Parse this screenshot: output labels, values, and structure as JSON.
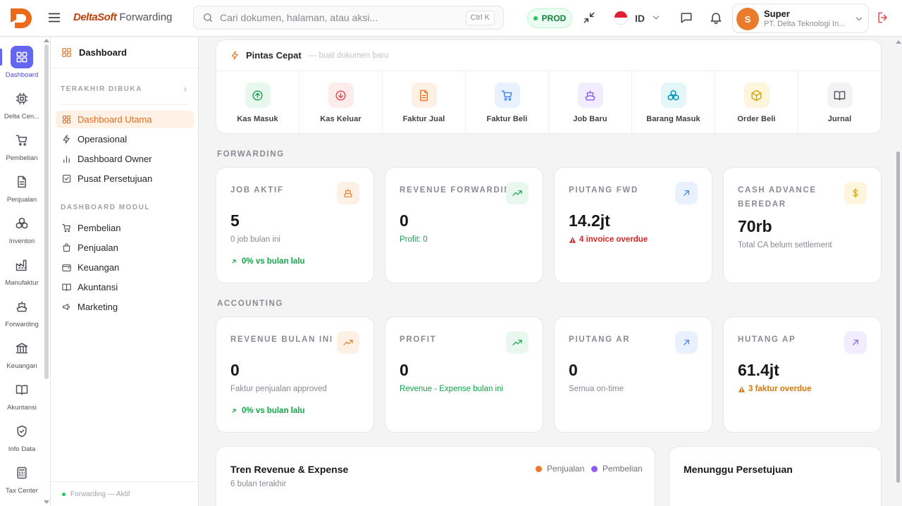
{
  "app": {
    "brand_name": "DeltaSoft",
    "module_name": "Forwarding"
  },
  "search": {
    "placeholder": "Cari dokumen, halaman, atau aksi...",
    "shortcut": "Ctrl K"
  },
  "env_badge": "PROD",
  "language": "ID",
  "user": {
    "initial": "S",
    "name": "Super",
    "company": "PT. Delta Teknologi In..."
  },
  "rail": {
    "items": [
      {
        "label": "Dashboard",
        "icon": "dashboard-icon",
        "active": true
      },
      {
        "label": "Delta Cen...",
        "icon": "cpu-icon"
      },
      {
        "label": "Pembelian",
        "icon": "cart-icon"
      },
      {
        "label": "Penjualan",
        "icon": "document-icon"
      },
      {
        "label": "Inventori",
        "icon": "boxes-icon"
      },
      {
        "label": "Manufaktur",
        "icon": "factory-icon"
      },
      {
        "label": "Forwarding",
        "icon": "ship-icon"
      },
      {
        "label": "Keuangan",
        "icon": "bank-icon"
      },
      {
        "label": "Akuntansi",
        "icon": "book-icon"
      },
      {
        "label": "Info Data",
        "icon": "shield-icon"
      },
      {
        "label": "Tax Center",
        "icon": "calculator-icon"
      }
    ]
  },
  "panel": {
    "title": "Dashboard",
    "recent_label": "TERAKHIR DIBUKA",
    "items": [
      {
        "label": "Dashboard Utama",
        "icon": "dashboard-icon",
        "active": true
      },
      {
        "label": "Operasional",
        "icon": "lightning-icon"
      },
      {
        "label": "Dashboard Owner",
        "icon": "bar-chart-icon"
      },
      {
        "label": "Pusat Persetujuan",
        "icon": "check-square-icon"
      }
    ],
    "module_label": "DASHBOARD MODUL",
    "modules": [
      {
        "label": "Pembelian",
        "icon": "cart-icon"
      },
      {
        "label": "Penjualan",
        "icon": "bag-icon"
      },
      {
        "label": "Keuangan",
        "icon": "wallet-icon"
      },
      {
        "label": "Akuntansi",
        "icon": "book-icon"
      },
      {
        "label": "Marketing",
        "icon": "megaphone-icon"
      }
    ],
    "footer": "Forwarding — Aktif"
  },
  "quick_actions": {
    "title": "Pintas Cepat",
    "subtitle": "— buat dokumen baru",
    "items": [
      {
        "label": "Kas Masuk",
        "icon": "arrow-up-circle-icon",
        "color": "#16a34a",
        "bg": "#e8f8ee"
      },
      {
        "label": "Kas Keluar",
        "icon": "arrow-down-circle-icon",
        "color": "#ef4444",
        "bg": "#fdecec"
      },
      {
        "label": "Faktur Jual",
        "icon": "invoice-icon",
        "color": "#ea7a2c",
        "bg": "#fdf0e4"
      },
      {
        "label": "Faktur Beli",
        "icon": "cart-icon",
        "color": "#3b82f6",
        "bg": "#e9f1fe"
      },
      {
        "label": "Job Baru",
        "icon": "ship-icon",
        "color": "#8b5cf6",
        "bg": "#f1ecfe"
      },
      {
        "label": "Barang Masuk",
        "icon": "boxes-icon",
        "color": "#0891b2",
        "bg": "#e3f6f8"
      },
      {
        "label": "Order Beli",
        "icon": "package-icon",
        "color": "#d9a100",
        "bg": "#fdf6dc"
      },
      {
        "label": "Jurnal",
        "icon": "book-icon",
        "color": "#52525b",
        "bg": "#f4f4f5"
      }
    ]
  },
  "forwarding": {
    "label": "FORWARDING",
    "cards": [
      {
        "label": "JOB AKTIF",
        "value": "5",
        "sub": "0 job bulan ini",
        "trend": "0% vs bulan lalu",
        "icon": "ship-icon",
        "color": "#ea7a2c",
        "bg": "#fdf0e4"
      },
      {
        "label": "REVENUE FORWARDING",
        "value": "0",
        "sub": "Profit: 0",
        "icon": "trending-up-icon",
        "color": "#16a34a",
        "bg": "#e8f8ee"
      },
      {
        "label": "PIUTANG FWD",
        "value": "14.2jt",
        "warning": "4 invoice overdue",
        "icon": "arrow-up-right-icon",
        "color": "#3b82f6",
        "bg": "#e9f1fe"
      },
      {
        "label": "CASH ADVANCE BEREDAR",
        "value": "70rb",
        "sub": "Total CA belum settlement",
        "icon": "dollar-icon",
        "color": "#d9a100",
        "bg": "#fdf6dc"
      }
    ]
  },
  "accounting": {
    "label": "ACCOUNTING",
    "cards": [
      {
        "label": "REVENUE BULAN INI",
        "value": "0",
        "sub": "Faktur penjualan approved",
        "trend": "0% vs bulan lalu",
        "icon": "trending-up-icon",
        "color": "#ea7a2c",
        "bg": "#fdf0e4"
      },
      {
        "label": "PROFIT",
        "value": "0",
        "sub": "Revenue - Expense bulan ini",
        "icon": "trending-up-icon",
        "color": "#16a34a",
        "bg": "#e8f8ee"
      },
      {
        "label": "PIUTANG AR",
        "value": "0",
        "sub": "Semua on-time",
        "icon": "arrow-up-right-icon",
        "color": "#3b82f6",
        "bg": "#e9f1fe"
      },
      {
        "label": "HUTANG AP",
        "value": "61.4jt",
        "warning": "3 faktur overdue",
        "icon": "arrow-up-right-icon",
        "color": "#8b5cf6",
        "bg": "#f1ecfe"
      }
    ]
  },
  "trend": {
    "title": "Tren Revenue & Expense",
    "subtitle": "6 bulan terakhir",
    "legend": [
      {
        "label": "Penjualan",
        "color": "#ea7a2c"
      },
      {
        "label": "Pembelian",
        "color": "#8b5cf6"
      }
    ]
  },
  "approval": {
    "title": "Menunggu Persetujuan"
  },
  "colors": {
    "accent": "#ea7a2c",
    "rail_active": "#6366f1",
    "success": "#16a34a",
    "danger": "#ef4444",
    "warning": "#d97706"
  }
}
